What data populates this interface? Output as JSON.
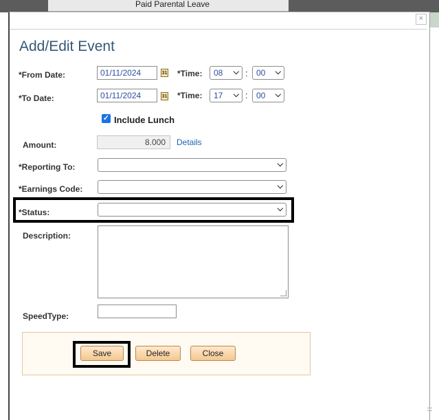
{
  "background": {
    "tab_text": "Paid Parental Leave"
  },
  "dialog": {
    "close_label": "×",
    "title": "Add/Edit Event",
    "from_date": {
      "label": "*From Date:",
      "value": "01/11/2024",
      "time_label": "*Time:",
      "hour": "08",
      "minute": "00"
    },
    "to_date": {
      "label": "*To Date:",
      "value": "01/11/2024",
      "time_label": "*Time:",
      "hour": "17",
      "minute": "00"
    },
    "calendar_icon_glyph": "31",
    "time_separator": ":",
    "include_lunch": {
      "label": "Include Lunch",
      "checked": true
    },
    "amount": {
      "label": "Amount:",
      "value": "8.000",
      "details_link": "Details"
    },
    "reporting_to": {
      "label": "*Reporting To:",
      "value": ""
    },
    "earnings_code": {
      "label": "*Earnings Code:",
      "value": ""
    },
    "status": {
      "label": "*Status:",
      "value": ""
    },
    "description": {
      "label": "Description:",
      "value": ""
    },
    "speedtype": {
      "label": "SpeedType:",
      "value": ""
    },
    "buttons": {
      "save": "Save",
      "delete": "Delete",
      "close": "Close"
    }
  },
  "icons": {
    "calendar": "calendar-icon",
    "chevron": "chevron-down-icon",
    "check": "checkmark-icon",
    "close": "close-icon"
  },
  "colors": {
    "title": "#345878",
    "link": "#1b62b3",
    "field_text": "#2c4f9c",
    "checkbox": "#1a73e8",
    "button_gradient_top": "#ffe9cc",
    "button_gradient_bottom": "#f4c892",
    "highlight_border": "#000000"
  }
}
